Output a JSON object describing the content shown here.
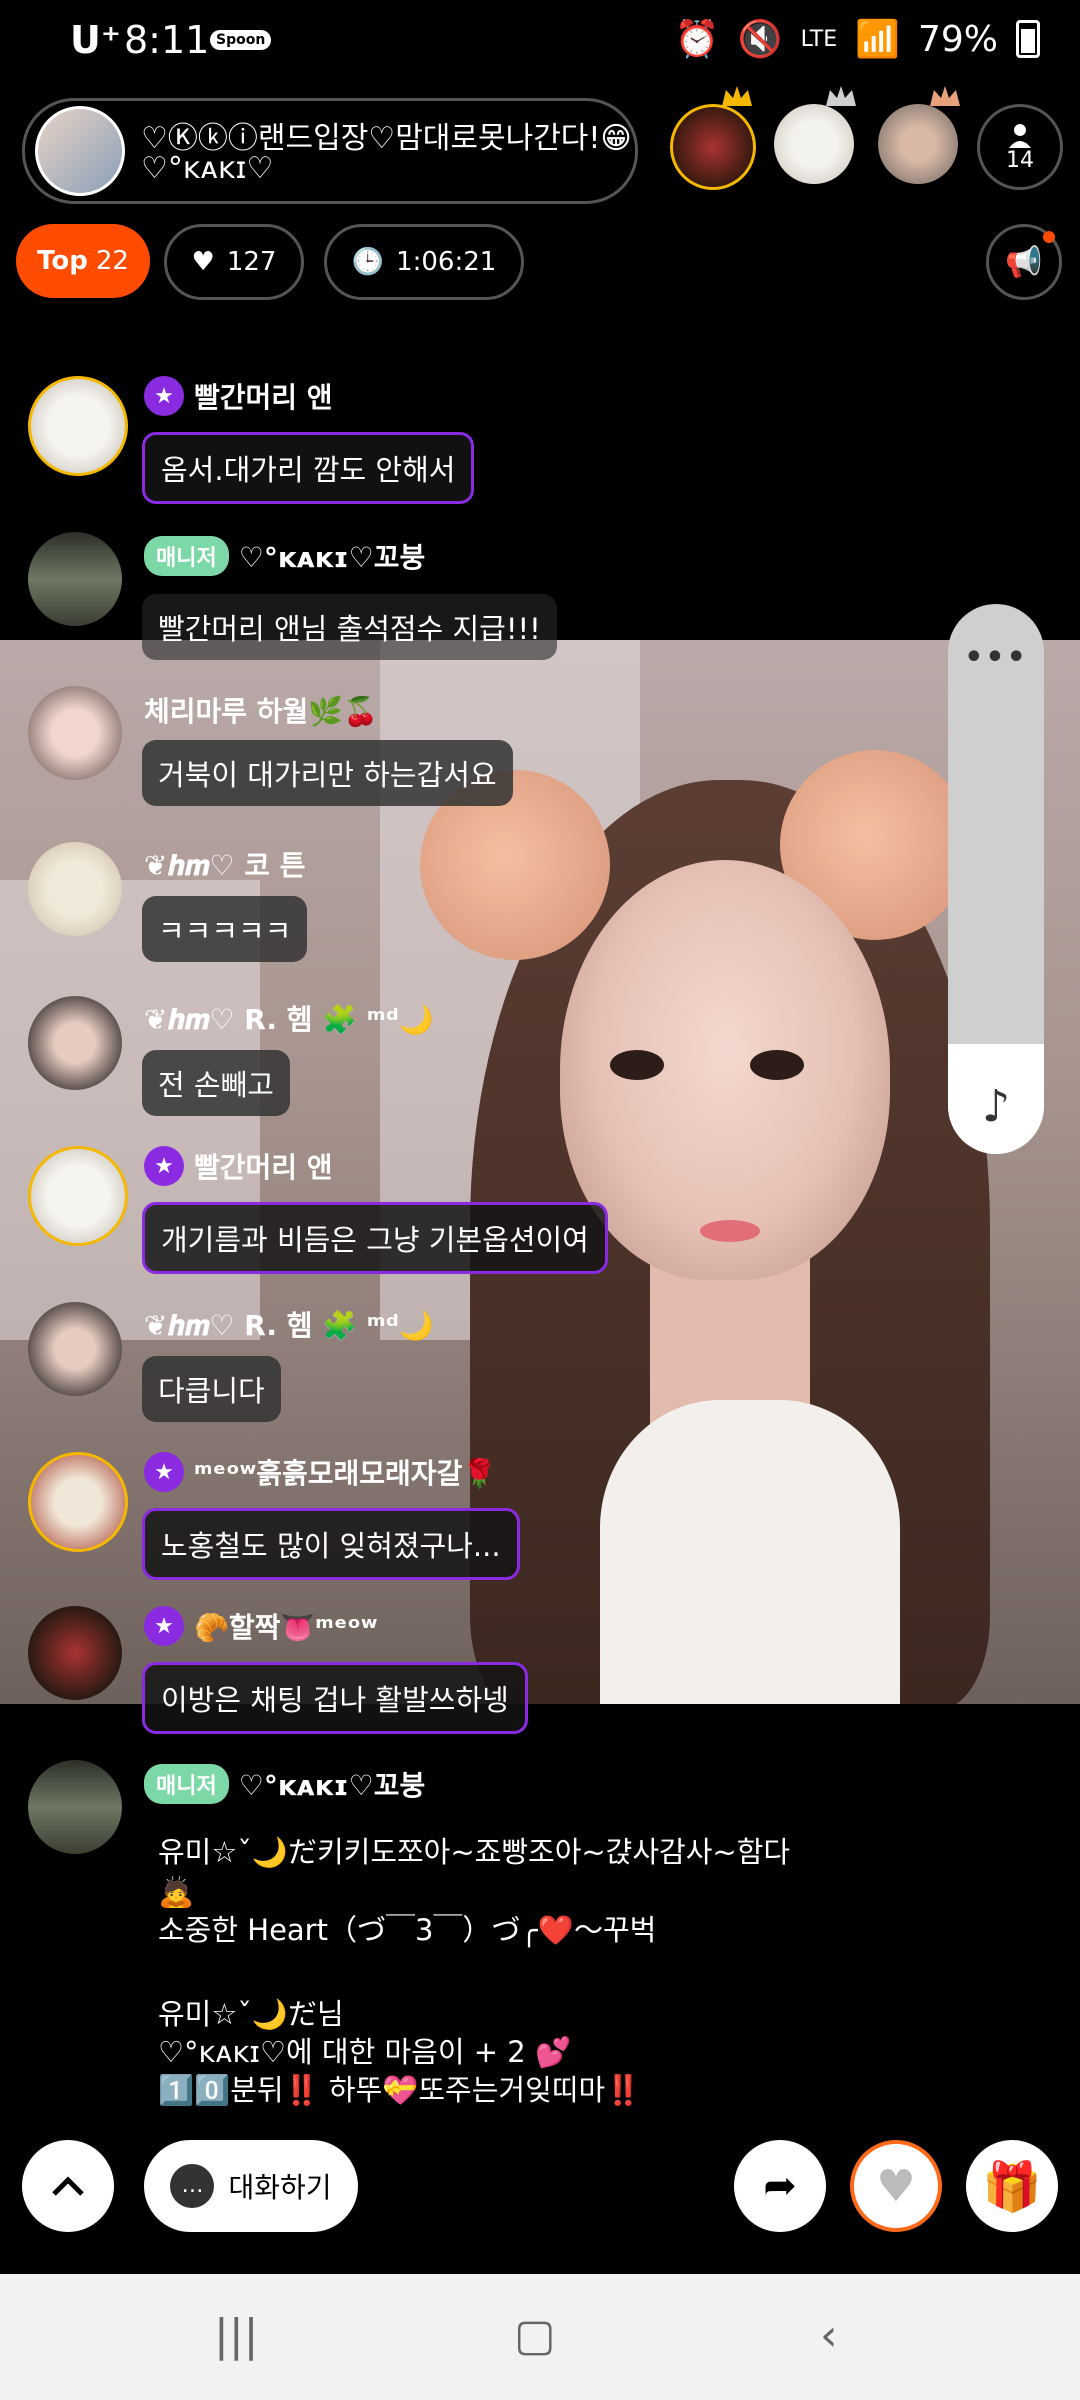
{
  "status": {
    "carrier": "U⁺",
    "time": "8:11",
    "app_badge": "Spoon",
    "network": "LTE",
    "battery": "79%"
  },
  "header": {
    "title_line1": "♡Ⓚⓚⓘ랜드입장♡맘대로못나간다!😁",
    "title_line2": "♡°ᴋᴀᴋɪ♡",
    "listener_count": "14"
  },
  "stats": {
    "top_label": "Top",
    "top_count": "22",
    "likes": "127",
    "duration": "1:06:21"
  },
  "colors": {
    "accent": "#ff4c00",
    "purple": "#8a2be2",
    "manager_green": "#7dd8a8"
  },
  "chat": {
    "m1": {
      "name": "빨간머리  앤",
      "text": "옴서.대가리 깜도 안해서",
      "rank": "1"
    },
    "m2": {
      "badge": "매니저",
      "name": "♡°ᴋᴀᴋɪ♡꼬붕",
      "text": "빨간머리  앤님 출석점수 지급!!!"
    },
    "m3": {
      "name": "체리마루 하월🌿🍒",
      "text": "거북이  대가리만  하는갑서요"
    },
    "m4": {
      "name": "❦𝒉𝒎♡ 코 튼",
      "text": "ㅋㅋㅋㅋㅋ"
    },
    "m5": {
      "name": "❦𝒉𝒎♡ R. 헴 🧩 ᵐᵈ🌙",
      "text": "전 손빼고"
    },
    "m6": {
      "name": "빨간머리  앤",
      "text": "개기름과 비듬은 그냥 기본옵션이여",
      "rank": "1"
    },
    "m7": {
      "name": "❦𝒉𝒎♡ R. 헴 🧩 ᵐᵈ🌙",
      "text": "다큽니다"
    },
    "m8": {
      "name": "ᵐᵉᵒʷ흙흙모래모래자갈🌹",
      "text": "노홍철도 많이 잊혀졌구나...",
      "rank": "1"
    },
    "m9": {
      "name": "🥐할짝👅ᵐᵉᵒʷ",
      "text": "이방은 채팅 겁나 활발쓰하넹",
      "rank": "2"
    },
    "m10": {
      "badge": "매니저",
      "name": "♡°ᴋᴀᴋɪ♡꼬붕",
      "line1": "유미☆ˇ🌙だ키키도쪼아~죠빵조아~갽사감사~함다",
      "line2": "🙇",
      "line3": "소중한 Heart（づ￣3￣）づ╭❤️～꾸벅",
      "line4": "유미☆ˇ🌙だ님",
      "line5": "♡°ᴋᴀᴋɪ♡에 대한 마음이 + 2 💕",
      "line6": "1️⃣0️⃣분뒤‼️ 하뚜💝또주는거잊띠마‼️"
    }
  },
  "bottom": {
    "chat_label": "대화하기"
  }
}
